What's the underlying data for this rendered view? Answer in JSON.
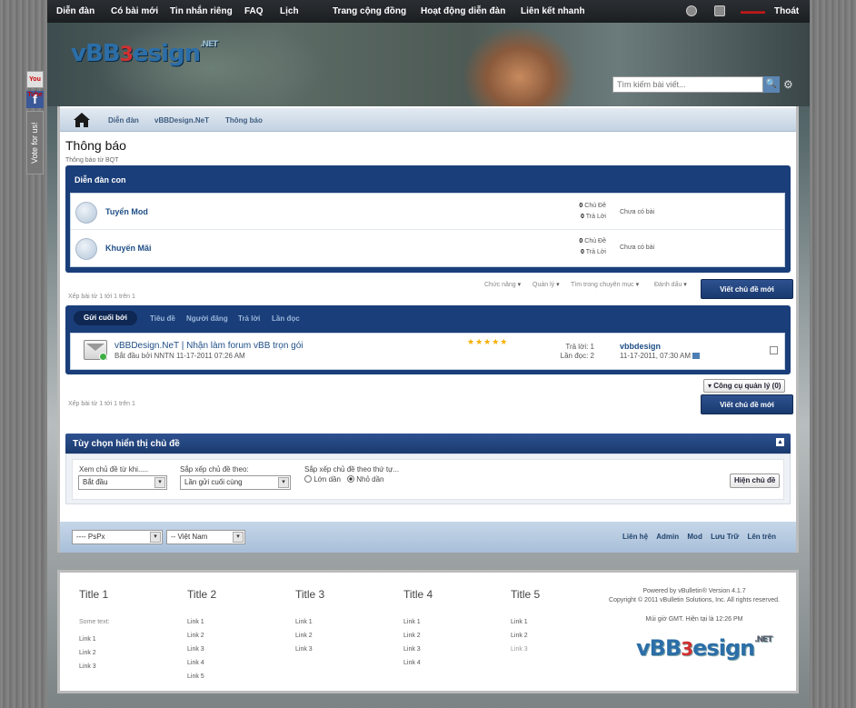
{
  "topnav": {
    "items": [
      "Diễn đàn",
      "Có bài mới",
      "Tin nhắn riêng",
      "FAQ",
      "Lịch",
      "Trang cộng đồng",
      "Hoạt động diễn đàn",
      "Liên kết nhanh"
    ],
    "logout": "Thoát"
  },
  "logo": {
    "main": "vBB",
    "accent": "3",
    "rest": "esign",
    "net": ".NET"
  },
  "search": {
    "placeholder": "Tìm kiếm bài viết..."
  },
  "social": {
    "youtube": "You Tube",
    "facebook": "f",
    "vote": "Vote for us!"
  },
  "breadcrumb": {
    "items": [
      "Diễn đàn",
      "vBBDesign.NeT",
      "Thông báo"
    ]
  },
  "page": {
    "title": "Thông báo",
    "subtitle": "Thông báo từ BQT"
  },
  "subforums": {
    "header": "Diễn đàn con",
    "rows": [
      {
        "name": "Tuyển Mod",
        "threads": "0",
        "threads_label": "Chủ Đề",
        "posts": "0",
        "posts_label": "Trả Lời",
        "last": "Chưa có bài"
      },
      {
        "name": "Khuyến Mãi",
        "threads": "0",
        "threads_label": "Chủ Đề",
        "posts": "0",
        "posts_label": "Trả Lời",
        "last": "Chưa có bài"
      }
    ]
  },
  "tools": {
    "items": [
      "Chức năng",
      "Quản lý",
      "Tìm trong chuyên mục",
      "Đánh dấu"
    ],
    "new_thread": "Viết chủ đề mới",
    "paging": "Xếp bài từ 1 tới 1 trên 1"
  },
  "threadlist": {
    "active_tab": "Gửi cuối bởi",
    "tabs": [
      "Tiêu đề",
      "Người đăng",
      "Trả lời",
      "Lần đọc"
    ],
    "thread": {
      "title": "vBBDesign.NeT | Nhận làm forum vBB trọn gói",
      "meta": "Bắt đầu bởi NNTN 11-17-2011 07:26 AM",
      "stars": "★★★★★",
      "replies": "Trả lời: 1",
      "views": "Lần đọc: 2",
      "last_user": "vbbdesign",
      "last_time": "11-17-2011, 07:30 AM"
    },
    "admin_tools": "▾ Công cụ quản lý (0)"
  },
  "options": {
    "header": "Tùy chọn hiển thị chủ đề",
    "show_from_label": "Xem chủ đề từ khi.....",
    "show_from_value": "Bắt đầu",
    "sort_by_label": "Sắp xếp chủ đề theo:",
    "sort_by_value": "Lần gửi cuối cùng",
    "order_label": "Sắp xếp chủ đề theo thứ tự...",
    "order_asc": "Lớn dần",
    "order_desc": "Nhỏ dần",
    "show_button": "Hiện chủ đề"
  },
  "footer": {
    "style_select": "---- PsPx",
    "lang_select": "-- Việt Nam",
    "links": [
      "Liên hệ",
      "Admin",
      "Mod",
      "Lưu Trữ",
      "Lên trên"
    ]
  },
  "bottom": {
    "columns": [
      {
        "title": "Title 1",
        "links": [
          "Some text:",
          "Link 1",
          "Link 2",
          "Link 3"
        ]
      },
      {
        "title": "Title 2",
        "links": [
          "Link 1",
          "Link 2",
          "Link 3",
          "Link 4",
          "Link 5"
        ]
      },
      {
        "title": "Title 3",
        "links": [
          "Link 1",
          "Link 2",
          "Link 3"
        ]
      },
      {
        "title": "Title 4",
        "links": [
          "Link 1",
          "Link 2",
          "Link 3",
          "Link 4"
        ]
      },
      {
        "title": "Title 5",
        "links": [
          "Link 1",
          "Link 2",
          "Link 3"
        ]
      }
    ],
    "powered": "Powered by vBulletin® Version 4.1.7",
    "copyright": "Copyright © 2011 vBulletin Solutions, Inc. All rights reserved.",
    "time": "Múi giờ GMT. Hiện tại là 12:26 PM"
  }
}
